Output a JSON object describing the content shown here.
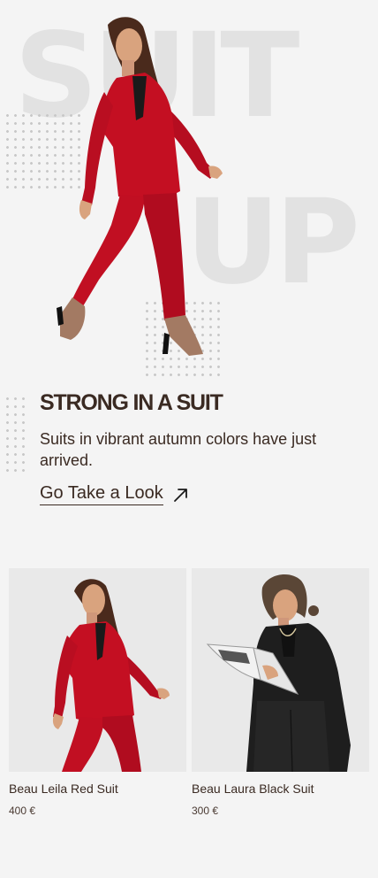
{
  "hero": {
    "bg_word_1": "SUIT",
    "bg_word_2": "UP",
    "headline": "STRONG IN A SUIT",
    "subtext": "Suits in vibrant autumn colors have just arrived.",
    "cta_label": "Go Take a Look",
    "cta_icon": "arrow-up-right-icon"
  },
  "products": [
    {
      "name": "Beau Leila Red Suit",
      "price": "400 €"
    },
    {
      "name": "Beau Laura Black Suit",
      "price": "300 €"
    }
  ],
  "colors": {
    "background": "#f4f4f4",
    "text": "#3a2a22",
    "suit_red": "#c40f22",
    "suit_black": "#1e1e1e",
    "watermark": "#e2e2e2"
  }
}
